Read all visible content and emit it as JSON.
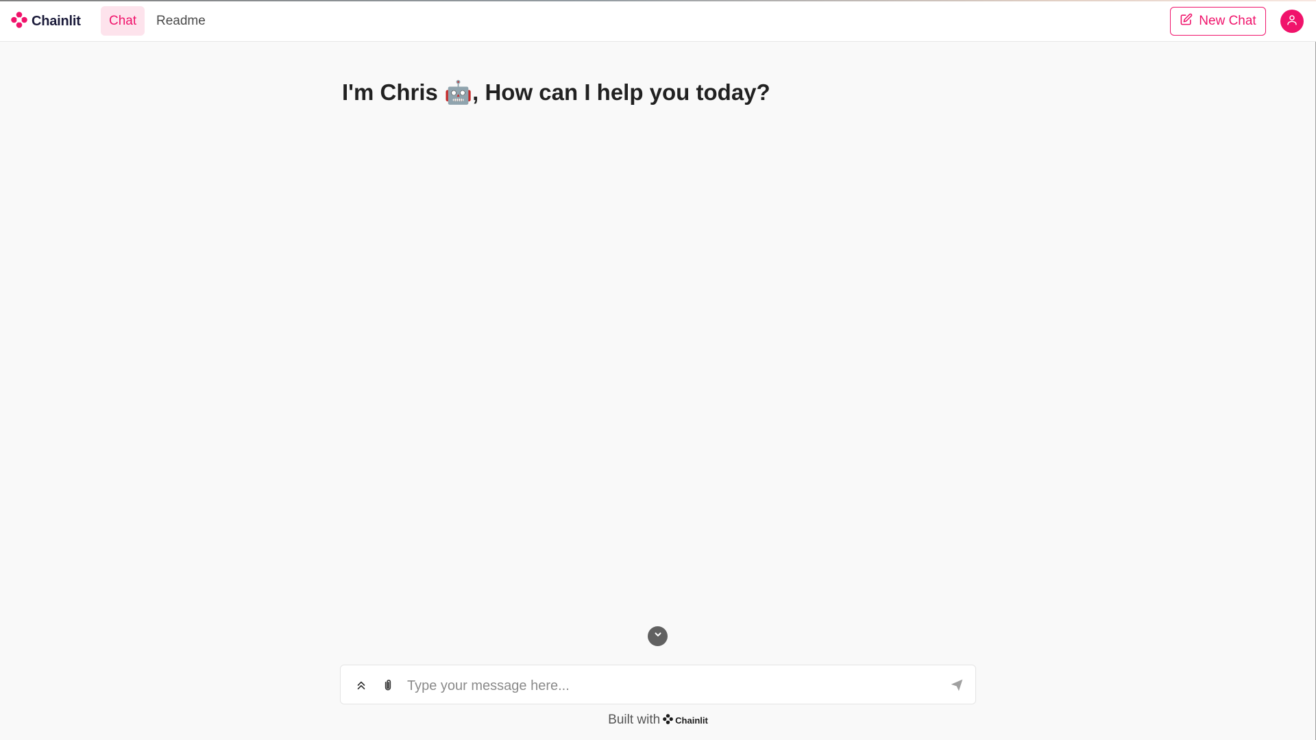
{
  "brand": {
    "name": "Chainlit",
    "accent_color": "#f0136b",
    "logo_icon": "chainlit-logo-icon"
  },
  "nav": {
    "tabs": [
      {
        "label": "Chat",
        "active": true
      },
      {
        "label": "Readme",
        "active": false
      }
    ]
  },
  "header": {
    "new_chat_label": "New Chat",
    "new_chat_icon": "edit-icon",
    "user_icon": "user-icon"
  },
  "main": {
    "welcome_text": "I'm Chris 🤖, How can I help you today?"
  },
  "composer": {
    "placeholder": "Type your message here...",
    "value": "",
    "icons": [
      "expand-icon",
      "paperclip-icon",
      "send-icon"
    ]
  },
  "scroll_button_icon": "chevron-down-icon",
  "footer": {
    "built_with_label": "Built with",
    "brand_name": "Chainlit"
  }
}
